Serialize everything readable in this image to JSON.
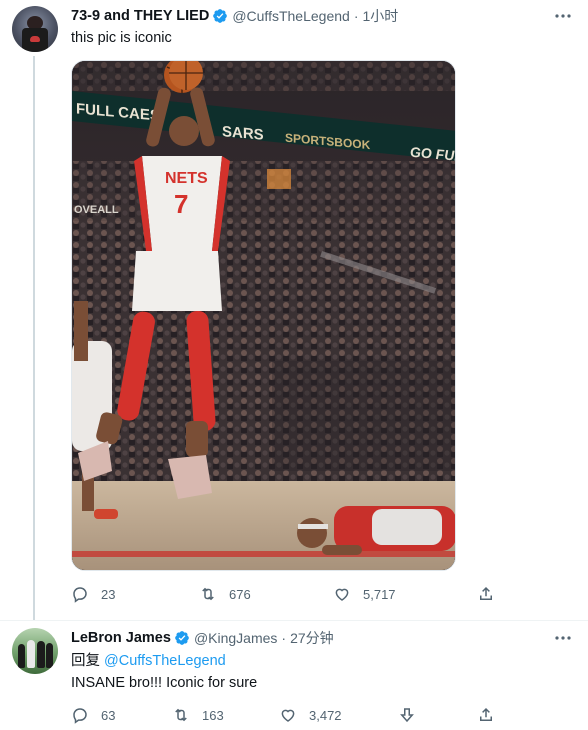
{
  "tweet1": {
    "display_name": "73-9 and THEY LIED",
    "handle": "@CuffsTheLegend",
    "separator": "·",
    "time": "1小时",
    "text": "this pic is iconic",
    "photo": {
      "banner_left": "FULL CAES",
      "banner_right": "SARS",
      "banner_sub": "SPORTSBOOK",
      "banner_far": "GO FUL",
      "side_sign": "OVEALL",
      "jersey_name": "NETS",
      "jersey_number": "7"
    },
    "actions": {
      "reply_count": "23",
      "retweet_count": "676",
      "like_count": "5,717"
    }
  },
  "tweet2": {
    "display_name": "LeBron James",
    "handle": "@KingJames",
    "separator": "·",
    "time": "27分钟",
    "reply_prefix": "回复 ",
    "reply_to_handle": "@CuffsTheLegend",
    "text": "INSANE bro!!! Iconic for sure",
    "actions": {
      "reply_count": "63",
      "retweet_count": "163",
      "like_count": "3,472"
    }
  },
  "colors": {
    "accent_blue": "#1d9bf0",
    "text_primary": "#0f1419",
    "text_secondary": "#536471",
    "thread_line": "#cfd9de"
  },
  "icons": {
    "verified": "verified-badge-icon",
    "more": "more-dots-icon",
    "reply": "reply-bubble-icon",
    "retweet": "retweet-arrows-icon",
    "like": "heart-icon",
    "share": "share-upload-icon",
    "downvote": "downvote-arrow-icon"
  }
}
